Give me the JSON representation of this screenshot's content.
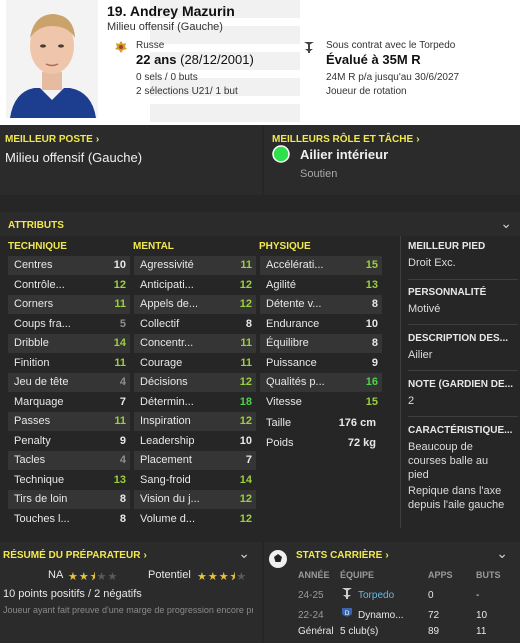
{
  "header": {
    "name": "19. Andrey Mazurin",
    "position": "Milieu offensif (Gauche)",
    "nationality": "Russe",
    "age_main": "22 ans",
    "age_dob": "(28/12/2001)",
    "caps": "0 sels / 0 buts",
    "u21": "2 sélections U21/ 1 but",
    "contract": "Sous contrat avec le Torpedo",
    "value": "Évalué à 35M R",
    "salary": "24M R p/a jusqu'au 30/6/2027",
    "role": "Joueur de rotation"
  },
  "best_position": {
    "title": "MEILLEUR POSTE",
    "value": "Milieu offensif (Gauche)"
  },
  "best_role": {
    "title": "MEILLEURS RÔLE ET TÂCHE",
    "role": "Ailier intérieur",
    "duty": "Soutien"
  },
  "attributes": {
    "title": "ATTRIBUTS",
    "technical_title": "TECHNIQUE",
    "mental_title": "MENTAL",
    "physical_title": "PHYSIQUE",
    "technical": [
      {
        "label": "Centres",
        "value": "10",
        "tone": "w"
      },
      {
        "label": "Contrôle...",
        "value": "12",
        "tone": "lg"
      },
      {
        "label": "Corners",
        "value": "11",
        "tone": "lg"
      },
      {
        "label": "Coups fra...",
        "value": "5",
        "tone": "g"
      },
      {
        "label": "Dribble",
        "value": "14",
        "tone": "lg"
      },
      {
        "label": "Finition",
        "value": "11",
        "tone": "lg"
      },
      {
        "label": "Jeu de tête",
        "value": "4",
        "tone": "g"
      },
      {
        "label": "Marquage",
        "value": "7",
        "tone": "w"
      },
      {
        "label": "Passes",
        "value": "11",
        "tone": "lg"
      },
      {
        "label": "Penalty",
        "value": "9",
        "tone": "w"
      },
      {
        "label": "Tacles",
        "value": "4",
        "tone": "g"
      },
      {
        "label": "Technique",
        "value": "13",
        "tone": "lg"
      },
      {
        "label": "Tirs de loin",
        "value": "8",
        "tone": "w"
      },
      {
        "label": "Touches l...",
        "value": "8",
        "tone": "w"
      }
    ],
    "mental": [
      {
        "label": "Agressivité",
        "value": "11",
        "tone": "lg"
      },
      {
        "label": "Anticipati...",
        "value": "12",
        "tone": "lg"
      },
      {
        "label": "Appels de...",
        "value": "12",
        "tone": "lg"
      },
      {
        "label": "Collectif",
        "value": "8",
        "tone": "w"
      },
      {
        "label": "Concentr...",
        "value": "11",
        "tone": "lg"
      },
      {
        "label": "Courage",
        "value": "11",
        "tone": "lg"
      },
      {
        "label": "Décisions",
        "value": "12",
        "tone": "lg"
      },
      {
        "label": "Détermin...",
        "value": "18",
        "tone": "bg"
      },
      {
        "label": "Inspiration",
        "value": "12",
        "tone": "lg"
      },
      {
        "label": "Leadership",
        "value": "10",
        "tone": "w"
      },
      {
        "label": "Placement",
        "value": "7",
        "tone": "w"
      },
      {
        "label": "Sang-froid",
        "value": "14",
        "tone": "lg"
      },
      {
        "label": "Vision du j...",
        "value": "12",
        "tone": "lg"
      },
      {
        "label": "Volume d...",
        "value": "12",
        "tone": "lg"
      }
    ],
    "physical": [
      {
        "label": "Accélérati...",
        "value": "15",
        "tone": "lg"
      },
      {
        "label": "Agilité",
        "value": "13",
        "tone": "lg"
      },
      {
        "label": "Détente v...",
        "value": "8",
        "tone": "w"
      },
      {
        "label": "Endurance",
        "value": "10",
        "tone": "w"
      },
      {
        "label": "Équilibre",
        "value": "8",
        "tone": "w"
      },
      {
        "label": "Puissance",
        "value": "9",
        "tone": "w"
      },
      {
        "label": "Qualités p...",
        "value": "16",
        "tone": "bg"
      },
      {
        "label": "Vitesse",
        "value": "15",
        "tone": "lg"
      }
    ],
    "height_label": "Taille",
    "height_value": "176 cm",
    "weight_label": "Poids",
    "weight_value": "72 kg"
  },
  "side_info": {
    "foot_title": "MEILLEUR PIED",
    "foot_value": "Droit Exc.",
    "personality_title": "PERSONNALITÉ",
    "personality_value": "Motivé",
    "description_title": "DESCRIPTION DES...",
    "description_value": "Ailier",
    "gk_title": "NOTE (GARDIEN DE...",
    "gk_value": "2",
    "traits_title": "CARACTÉRISTIQUE...",
    "trait_1": "Beaucoup de courses balle au pied",
    "trait_2": "Repique dans l'axe depuis l'aile gauche"
  },
  "coach_report": {
    "title": "RÉSUMÉ DU PRÉPARATEUR",
    "current_label": "NA",
    "current_stars": 2.5,
    "potential_label": "Potentiel",
    "potential_stars": 3.5,
    "points": "10 points positifs / 2 négatifs",
    "note": "Joueur ayant fait preuve d'une marge de progression encore progresser"
  },
  "career": {
    "title": "STATS CARRIÈRE",
    "col_year": "ANNÉE",
    "col_team": "ÉQUIPE",
    "col_apps": "APPS",
    "col_goals": "BUTS",
    "rows": [
      {
        "year": "24-25",
        "team": "Torpedo",
        "apps": "0",
        "goals": "-"
      },
      {
        "year": "22-24",
        "team": "Dynamo...",
        "apps": "72",
        "goals": "10"
      }
    ],
    "total_label": "Général",
    "total_clubs": "5 club(s)",
    "total_apps": "89",
    "total_goals": "11"
  },
  "colors": {
    "accent": "#f2e94e",
    "good": "#9bcf3d",
    "excellent": "#4fd14f",
    "weak": "#8e8e8e",
    "background": "#262626"
  }
}
